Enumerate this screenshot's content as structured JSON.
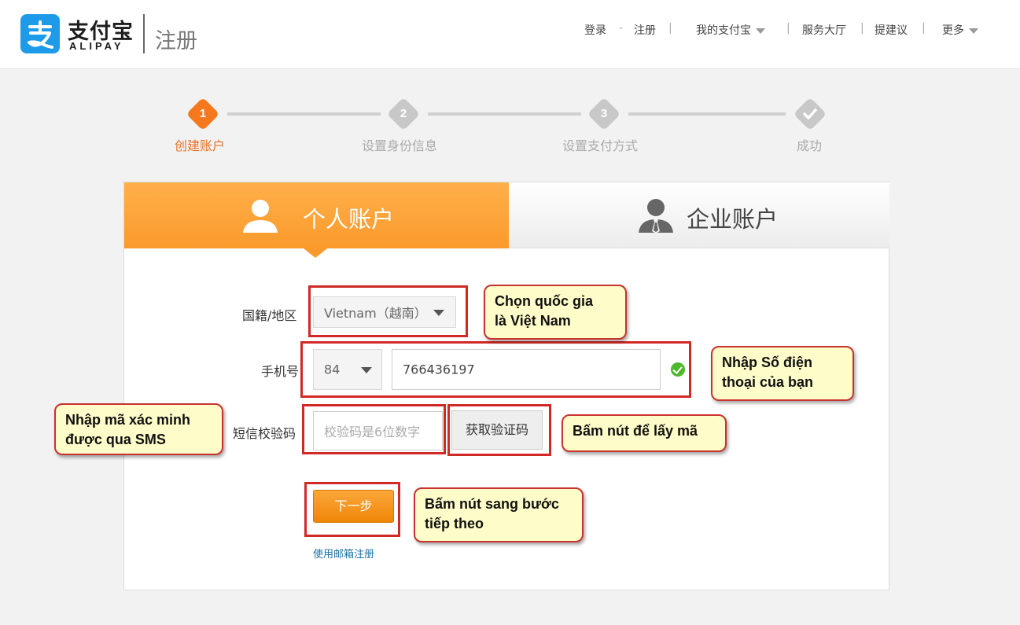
{
  "brand": {
    "cn": "支付宝",
    "en": "ALIPAY",
    "page_title": "注册"
  },
  "nav": {
    "login": "登录",
    "dash": "-",
    "register": "注册",
    "sep": "|",
    "my_alipay": "我的支付宝",
    "service_hall": "服务大厅",
    "suggest": "提建议",
    "more": "更多"
  },
  "steps": [
    {
      "num": "1",
      "label": "创建账户",
      "active": true
    },
    {
      "num": "2",
      "label": "设置身份信息",
      "active": false
    },
    {
      "num": "3",
      "label": "设置支付方式",
      "active": false
    },
    {
      "num": "",
      "label": "成功",
      "active": false
    }
  ],
  "tabs": {
    "personal": "个人账户",
    "business": "企业账户"
  },
  "form": {
    "country_label": "国籍/地区",
    "country_value": "Vietnam（越南）",
    "phone_label": "手机号",
    "phone_code": "84",
    "phone_value": "766436197",
    "sms_label": "短信校验码",
    "sms_placeholder": "校验码是6位数字",
    "get_code": "获取验证码",
    "next": "下一步",
    "email_register": "使用邮箱注册"
  },
  "annotations": {
    "country": [
      "Chọn quốc gia",
      "là Việt Nam"
    ],
    "phone": [
      "Nhập Số điện",
      "thoại của bạn"
    ],
    "sms": [
      "Nhập mã xác minh",
      "được qua SMS"
    ],
    "get_code": "Bấm nút để lấy mã",
    "next": [
      "Bấm nút sang bước",
      "tiếp theo"
    ]
  },
  "colors": {
    "accent": "#f5781f",
    "alipay_blue": "#1e9be8",
    "annotation_red": "#d12a26",
    "annotation_bg": "#fefcc8"
  }
}
